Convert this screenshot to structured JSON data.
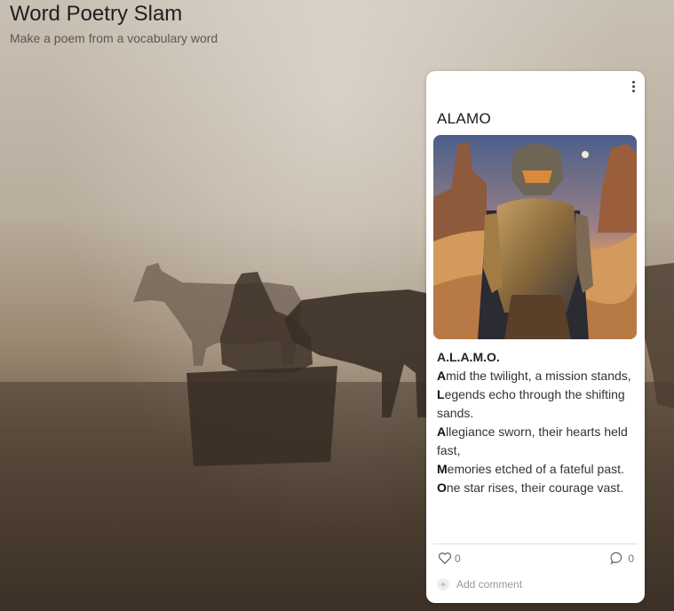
{
  "header": {
    "title": "Word Poetry Slam",
    "subtitle": "Make a poem from a vocabulary word"
  },
  "card": {
    "word": "ALAMO",
    "image_alt": "armored knight in desert",
    "poem_title": "A.L.A.M.O.",
    "poem_lines": [
      {
        "initial": "A",
        "rest": "mid the twilight, a mission stands,"
      },
      {
        "initial": "L",
        "rest": "egends echo through the shifting sands."
      },
      {
        "initial": "A",
        "rest": "llegiance sworn, their hearts held fast,"
      },
      {
        "initial": "M",
        "rest": "emories etched of a fateful past."
      },
      {
        "initial": "O",
        "rest": "ne star rises, their courage vast."
      }
    ],
    "likes_count": "0",
    "comments_count": "0",
    "add_comment_label": "Add comment"
  },
  "icons": {
    "menu": "more-vertical-icon",
    "like": "heart-icon",
    "comment": "comment-bubble-icon",
    "add": "plus-circle-icon"
  }
}
